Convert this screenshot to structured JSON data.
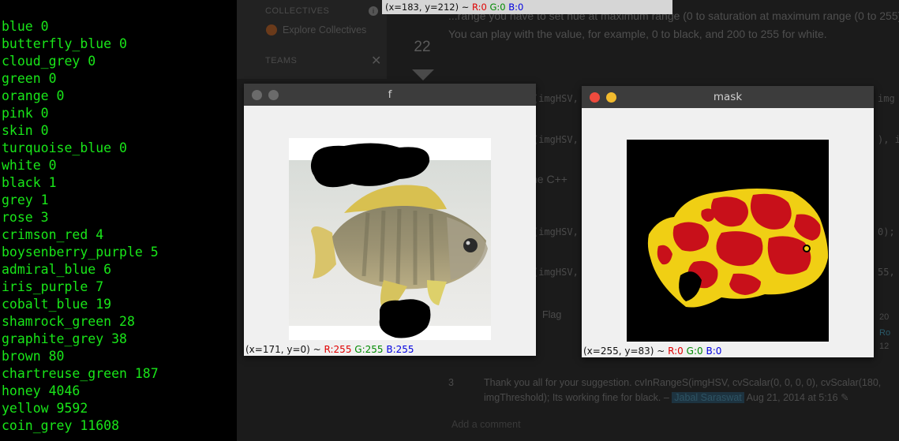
{
  "terminal": {
    "lines": [
      "blue 0",
      "butterfly_blue 0",
      "cloud_grey 0",
      "green 0",
      "orange 0",
      "pink 0",
      "skin 0",
      "turquoise_blue 0",
      "white 0",
      "black 1",
      "grey 1",
      "rose 3",
      "crimson_red 4",
      "boysenberry_purple 5",
      "admiral_blue 6",
      "iris_purple 7",
      "cobalt_blue 19",
      "shamrock_green 28",
      "graphite_grey 38",
      "brown 80",
      "chartreuse_green 187",
      "honey 4046",
      "yellow 9592",
      "coin_grey 11608"
    ]
  },
  "top_status": {
    "coords": "(x=183, y=212) ~ ",
    "r": "R:0",
    "g": "G:0",
    "b": "B:0"
  },
  "window_f": {
    "title": "f",
    "status": {
      "coords": "(x=171, y=0) ~ ",
      "r": "R:255",
      "g": "G:255",
      "b": "B:255"
    }
  },
  "window_mask": {
    "title": "mask",
    "status": {
      "coords": "(x=255, y=83) ~ ",
      "r": "R:0",
      "g": "G:0",
      "b": "B:0"
    }
  },
  "background_page": {
    "collectives_label": "COLLECTIVES",
    "explore_collectives": "Explore Collectives",
    "teams_label": "TEAMS",
    "vote_count": "22",
    "answer_text": "...range you have to set hue at maximum range (0 to saturation at maximum range (0 to 255). You can play with the value, for example, 0 to black, and 200 to 255 for white.",
    "code1": "(imgHSV,",
    "code1b": "img",
    "code2": "(imgHSV, ",
    "code2b": "), i",
    "cpp": "he C++",
    "code3": "(imgHSV,",
    "code3b": "0);",
    "code4": "(imgHSV,",
    "code4b": "55,",
    "flag": "Flag",
    "side_a": "20",
    "side_b": "Ro",
    "side_c": "12",
    "comment_votes": "3",
    "comment_text": "Thank you all for your suggestion. cvInRangeS(imgHSV, cvScalar(0, 0, 0, 0), cvScalar(180, imgThreshold); Its working fine for black. – ",
    "comment_user": "Jabal Saraswat",
    "comment_date": "Aug 21, 2014 at 5:16",
    "add_comment": "Add a comment"
  }
}
